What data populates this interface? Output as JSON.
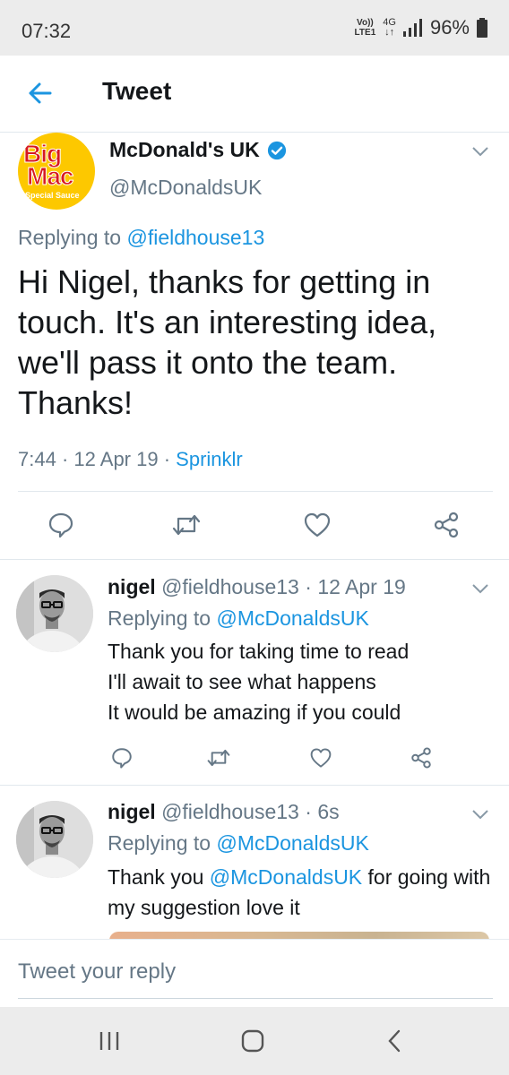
{
  "status_bar": {
    "time": "07:32",
    "volte": "Vo))\nLTE1",
    "network": "4G",
    "battery": "96%"
  },
  "app_bar": {
    "title": "Tweet",
    "back_icon": "arrow-left-icon"
  },
  "main_tweet": {
    "name": "McDonald's UK",
    "handle": "@McDonaldsUK",
    "avatar_text": [
      "Big",
      "Mac",
      "Special Sauce"
    ],
    "replying_label": "Replying to",
    "replying_to": "@fieldhouse13",
    "text": "Hi Nigel, thanks for getting in touch. It's an interesting idea, we'll pass it onto the team. Thanks!",
    "time": "7:44",
    "date": "12 Apr 19",
    "source": "Sprinklr",
    "separator": "·"
  },
  "replies": [
    {
      "name": "nigel",
      "handle": "@fieldhouse13",
      "time": "12 Apr 19",
      "replying_label": "Replying to",
      "replying_to": "@McDonaldsUK",
      "lines": [
        "Thank you for taking time to read",
        "I'll await to see what happens",
        "It would be amazing if you could"
      ]
    },
    {
      "name": "nigel",
      "handle": "@fieldhouse13",
      "time": "6s",
      "replying_label": "Replying to",
      "replying_to": "@McDonaldsUK",
      "text_before": "Thank you",
      "text_mention": "@McDonaldsUK",
      "text_after": "for going with my suggestion love it"
    }
  ],
  "composer": {
    "placeholder": "Tweet your reply"
  },
  "colors": {
    "link": "#1b95e0",
    "muted": "#657786",
    "text": "#14171a",
    "avatar_bg": "#fdc800",
    "logo_red": "#d71920"
  }
}
